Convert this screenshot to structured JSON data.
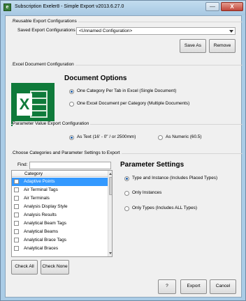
{
  "window": {
    "title": "Subscription Exeler8 - Simple Export v2013.6.27.0",
    "minimize_glyph": "—",
    "close_glyph": "X",
    "app_icon_glyph": "e"
  },
  "reusable": {
    "group_title": "Reusable Export Configurations",
    "saved_label": "Saved Export Configurations",
    "saved_value": "<Unnamed Configuration>",
    "save_as_label": "Save As",
    "remove_label": "Remove"
  },
  "excel_config": {
    "group_title": "Excel Document Configuration",
    "heading": "Document Options",
    "option_one": "One Category Per Tab in Excel (Single Document)",
    "option_two": "One Excel Document per Category (Multiple Documents)",
    "logo_glyph": "X"
  },
  "param_value": {
    "group_title": "Parameter Value Export Configuration",
    "as_text": "As Text (16' - 0\" / or 2500mm)",
    "as_numeric": "As Numeric (60.5)"
  },
  "choose": {
    "group_title": "Choose Categories and Parameter Settings to Export",
    "find_label": "Find:",
    "find_value": "",
    "column_header": "Category",
    "categories": [
      {
        "label": "Adaptive Points",
        "selected": true
      },
      {
        "label": "Air Terminal Tags",
        "selected": false
      },
      {
        "label": "Air Terminals",
        "selected": false
      },
      {
        "label": "Analysis Display Style",
        "selected": false
      },
      {
        "label": "Analysis Results",
        "selected": false
      },
      {
        "label": "Analytical Beam Tags",
        "selected": false
      },
      {
        "label": "Analytical Beams",
        "selected": false
      },
      {
        "label": "Analytical Brace Tags",
        "selected": false
      },
      {
        "label": "Analytical Braces",
        "selected": false
      }
    ],
    "check_all_label": "Check All",
    "check_none_label": "Check None"
  },
  "parameter_settings": {
    "heading": "Parameter Settings",
    "type_and_instance": "Type and Instance (Includes Placed Types)",
    "only_instances": "Only Instances",
    "only_types": "Only Types (Includes ALL Types)"
  },
  "footer": {
    "help_label": "?",
    "export_label": "Export",
    "cancel_label": "Cancel"
  },
  "colors": {
    "window_frame": "#aacce6",
    "selection": "#3399ff",
    "excel_green": "#0f7a3a"
  }
}
